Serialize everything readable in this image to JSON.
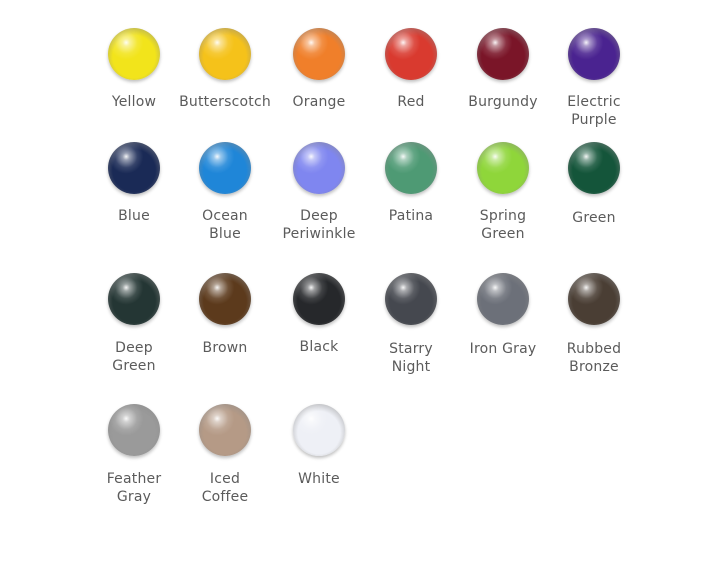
{
  "colors": [
    {
      "label": "Yellow",
      "hex": "#f2e41b"
    },
    {
      "label": "Butterscotch",
      "hex": "#f5c21a"
    },
    {
      "label": "Orange",
      "hex": "#f07f2a"
    },
    {
      "label": "Red",
      "hex": "#d93a2f"
    },
    {
      "label": "Burgundy",
      "hex": "#7a1528"
    },
    {
      "label": "Electric\nPurple",
      "hex": "#4a2390"
    },
    {
      "label": "Blue",
      "hex": "#1a2a56"
    },
    {
      "label": "Ocean\nBlue",
      "hex": "#1f86d8"
    },
    {
      "label": "Deep\nPeriwinkle",
      "hex": "#7f86f0"
    },
    {
      "label": "Patina",
      "hex": "#4e9a74"
    },
    {
      "label": "Spring\nGreen",
      "hex": "#8fd63a"
    },
    {
      "label": "Green",
      "hex": "#14553a"
    },
    {
      "label": "Deep\nGreen",
      "hex": "#243634"
    },
    {
      "label": "Brown",
      "hex": "#5c3a1c"
    },
    {
      "label": "Black",
      "hex": "#26282b"
    },
    {
      "label": "Starry\nNight",
      "hex": "#45484f"
    },
    {
      "label": "Iron Gray",
      "hex": "#6c7079"
    },
    {
      "label": "Rubbed\nBronze",
      "hex": "#4a3e34"
    },
    {
      "label": "Feather\nGray",
      "hex": "#9a9a9a"
    },
    {
      "label": "Iced\nCoffee",
      "hex": "#b59a86"
    },
    {
      "label": "White",
      "hex": "#eef0f6"
    }
  ]
}
